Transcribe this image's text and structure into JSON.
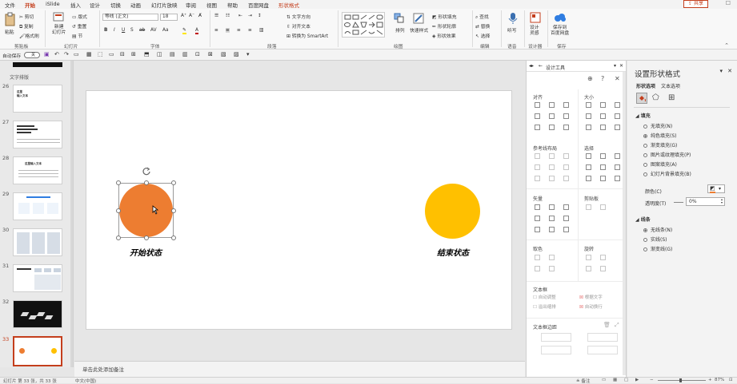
{
  "menu": {
    "tabs": [
      "文件",
      "开始",
      "iSlide",
      "插入",
      "设计",
      "切换",
      "动画",
      "幻灯片放映",
      "审阅",
      "视图",
      "帮助",
      "百度网盘",
      "形状格式"
    ],
    "share_label": "共享"
  },
  "ribbon": {
    "paste": "粘贴",
    "cut": "剪切",
    "copy": "复制",
    "format_painter": "格式刷",
    "new_slide": "新建\n幻灯片",
    "layout": "版式",
    "reset": "重置",
    "section": "节",
    "font_name": "等线 (正文)",
    "font_size": "18",
    "text_direction": "文字方向",
    "align_text": "对齐文本",
    "smartart": "转换为 SmartArt",
    "arrange": "排列",
    "quick_styles": "快速样式",
    "shape_fill": "形状填充",
    "shape_outline": "形状轮廓",
    "shape_effects": "形状效果",
    "find": "查找",
    "replace": "替换",
    "select": "选择",
    "dictate": "听写",
    "designer": "设计\n灵感",
    "save_to_baidu": "保存到\n百度网盘",
    "groups": {
      "clipboard": "剪贴板",
      "slides": "幻灯片",
      "font": "字体",
      "paragraph": "段落",
      "drawing": "绘图",
      "editing": "编辑",
      "voice": "语音",
      "designer": "设计器",
      "save": "保存"
    }
  },
  "qat": {
    "autosave_label": "自动保存",
    "autosave_state": "关"
  },
  "thumbnails": {
    "section_label": "文字排版",
    "numbers": [
      "26",
      "27",
      "28",
      "29",
      "30",
      "31",
      "32",
      "33"
    ],
    "selected": "33",
    "thumb_texts": [
      "这里\n输入文本",
      "这里\n输入文本",
      "这里输入文本"
    ]
  },
  "slide": {
    "start_label": "开始状态",
    "end_label": "结束状态",
    "start_color": "#ed7d31",
    "end_color": "#ffc000"
  },
  "notes_placeholder": "单击此处添加备注",
  "design_tools": {
    "title": "设计工具",
    "align": "对齐",
    "size": "大小",
    "guides": "参考线布局",
    "select": "选择",
    "vector": "矢量",
    "clip": "剪贴板",
    "color": "取色",
    "rotate": "旋转",
    "textbox": "文本框",
    "auto_adjust": "自动调整",
    "overflow_shrink": "溢出缩排",
    "auto_wrap_text": "根据文字",
    "auto_wrap": "自动换行",
    "textbox_margin": "文本框边距"
  },
  "format_pane": {
    "title": "设置形状格式",
    "tab_shape": "形状选项",
    "tab_text": "文本选项",
    "fill_header": "填充",
    "fill_options": [
      "无填充(N)",
      "纯色填充(S)",
      "渐变填充(G)",
      "图片或纹理填充(P)",
      "图案填充(A)",
      "幻灯片背景填充(B)"
    ],
    "fill_selected": 1,
    "color_label": "颜色(C)",
    "transparency_label": "透明度(T)",
    "transparency_value": "0%",
    "line_header": "线条",
    "line_options": [
      "无线条(N)",
      "实线(S)",
      "渐变线(G)"
    ],
    "line_selected": 0
  },
  "statusbar": {
    "slide_info": "幻灯片 第 33 张，共 33 张",
    "language": "中文(中国)",
    "notes": "备注",
    "zoom": "87%"
  },
  "colors": {
    "accent": "#c43e1c"
  }
}
